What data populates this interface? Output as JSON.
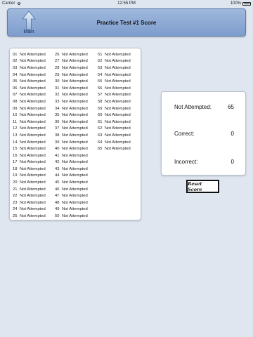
{
  "status_bar": {
    "carrier": "Carrier",
    "time": "12:55 PM",
    "battery": "100%"
  },
  "header": {
    "title": "Practice Test #1 Score",
    "main_label": "Main"
  },
  "questions": {
    "col1": [
      {
        "num": "01",
        "status": "Not Attempted"
      },
      {
        "num": "02",
        "status": "Not Attempted"
      },
      {
        "num": "03",
        "status": "Not Attempted"
      },
      {
        "num": "04",
        "status": "Not Attempted"
      },
      {
        "num": "05",
        "status": "Not Attempted"
      },
      {
        "num": "06",
        "status": "Not Attempted"
      },
      {
        "num": "07",
        "status": "Not Attempted"
      },
      {
        "num": "08",
        "status": "Not Attempted"
      },
      {
        "num": "09",
        "status": "Not Attempted"
      },
      {
        "num": "10",
        "status": "Not Attempted"
      },
      {
        "num": "11",
        "status": "Not Attempted"
      },
      {
        "num": "12",
        "status": "Not Attempted"
      },
      {
        "num": "13",
        "status": "Not Attempted"
      },
      {
        "num": "14",
        "status": "Not Attempted"
      },
      {
        "num": "15",
        "status": "Not Attempted"
      },
      {
        "num": "16",
        "status": "Not Attempted"
      },
      {
        "num": "17",
        "status": "Not Attempted"
      },
      {
        "num": "18",
        "status": "Not Attempted"
      },
      {
        "num": "19",
        "status": "Not Attempted"
      },
      {
        "num": "20",
        "status": "Not Attempted"
      },
      {
        "num": "21",
        "status": "Not Attempted"
      },
      {
        "num": "22",
        "status": "Not Attempted"
      },
      {
        "num": "23",
        "status": "Not Attempted"
      },
      {
        "num": "24",
        "status": "Not Attempted"
      },
      {
        "num": "25",
        "status": "Not Attempted"
      }
    ],
    "col2": [
      {
        "num": "26",
        "status": "Not Attempted"
      },
      {
        "num": "27",
        "status": "Not Attempted"
      },
      {
        "num": "28",
        "status": "Not Attempted"
      },
      {
        "num": "29",
        "status": "Not Attempted"
      },
      {
        "num": "30",
        "status": "Not Attempted"
      },
      {
        "num": "31",
        "status": "Not Attempted"
      },
      {
        "num": "32",
        "status": "Not Attempted"
      },
      {
        "num": "33",
        "status": "Not Attempted"
      },
      {
        "num": "34",
        "status": "Not Attempted"
      },
      {
        "num": "35",
        "status": "Not Attempted"
      },
      {
        "num": "36",
        "status": "Not Attempted"
      },
      {
        "num": "37",
        "status": "Not Attempted"
      },
      {
        "num": "38",
        "status": "Not Attempted"
      },
      {
        "num": "39",
        "status": "Not Attempted"
      },
      {
        "num": "40",
        "status": "Not Attempted"
      },
      {
        "num": "41",
        "status": "Not Attempted"
      },
      {
        "num": "42",
        "status": "Not Attempted"
      },
      {
        "num": "43",
        "status": "Not Attempted"
      },
      {
        "num": "44",
        "status": "Not Attempted"
      },
      {
        "num": "45",
        "status": "Not Attempted"
      },
      {
        "num": "46",
        "status": "Not Attempted"
      },
      {
        "num": "47",
        "status": "Not Attempted"
      },
      {
        "num": "48",
        "status": "Not Attempted"
      },
      {
        "num": "49",
        "status": "Not Attempted"
      },
      {
        "num": "50",
        "status": "Not Attempted"
      }
    ],
    "col3": [
      {
        "num": "51",
        "status": "Not Attempted"
      },
      {
        "num": "52",
        "status": "Not Attempted"
      },
      {
        "num": "53",
        "status": "Not Attempted"
      },
      {
        "num": "54",
        "status": "Not Attempted"
      },
      {
        "num": "55",
        "status": "Not Attempted"
      },
      {
        "num": "56",
        "status": "Not Attempted"
      },
      {
        "num": "57",
        "status": "Not Attempted"
      },
      {
        "num": "58",
        "status": "Not Attempted"
      },
      {
        "num": "59",
        "status": "Not Attempted"
      },
      {
        "num": "60",
        "status": "Not Attempted"
      },
      {
        "num": "61",
        "status": "Not Attempted"
      },
      {
        "num": "62",
        "status": "Not Attempted"
      },
      {
        "num": "63",
        "status": "Not Attempted"
      },
      {
        "num": "64",
        "status": "Not Attempted"
      },
      {
        "num": "65",
        "status": "Not Attempted"
      }
    ]
  },
  "score": {
    "not_attempted_label": "Not Attempted:",
    "not_attempted_value": "65",
    "correct_label": "Correct:",
    "correct_value": "0",
    "incorrect_label": "Incorrect:",
    "incorrect_value": "0"
  },
  "reset_label": "Reset Score"
}
